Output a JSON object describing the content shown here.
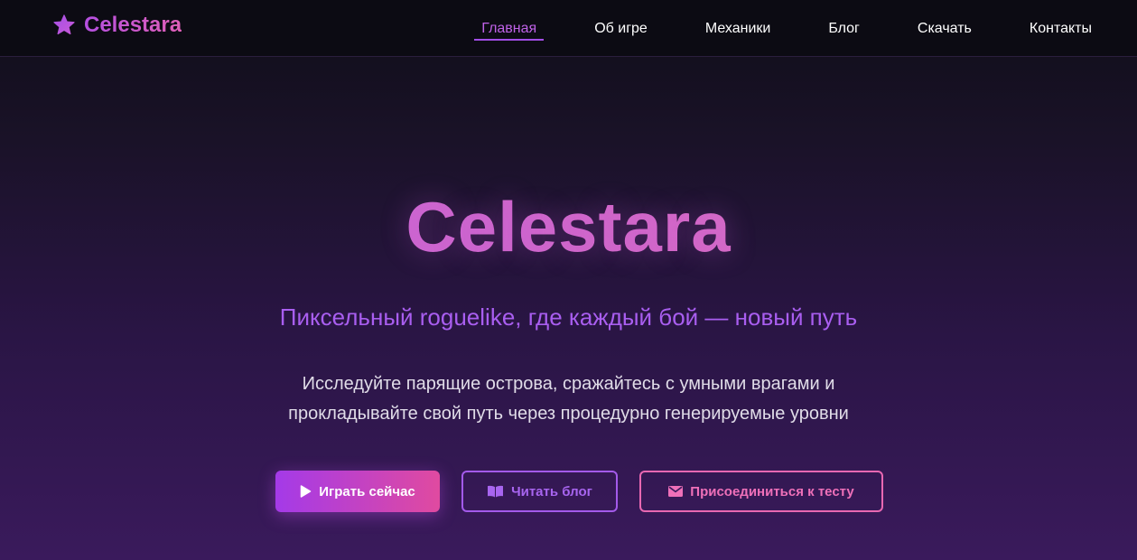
{
  "brand": {
    "name": "Celestara",
    "icon": "star-icon"
  },
  "nav": {
    "items": [
      {
        "label": "Главная",
        "active": true
      },
      {
        "label": "Об игре",
        "active": false
      },
      {
        "label": "Механики",
        "active": false
      },
      {
        "label": "Блог",
        "active": false
      },
      {
        "label": "Скачать",
        "active": false
      },
      {
        "label": "Контакты",
        "active": false
      }
    ]
  },
  "hero": {
    "title": "Celestara",
    "subtitle": "Пиксельный roguelike, где каждый бой — новый путь",
    "desc_line1": "Исследуйте парящие острова, сражайтесь с умными врагами и",
    "desc_line2": "прокладывайте свой путь через процедурно генерируемые уровни"
  },
  "actions": {
    "play": {
      "label": "Играть сейчас",
      "icon": "play-icon"
    },
    "blog": {
      "label": "Читать блог",
      "icon": "book-icon"
    },
    "join": {
      "label": "Присоединиться к тесту",
      "icon": "envelope-icon"
    }
  },
  "colors": {
    "accent_purple": "#a24de6",
    "accent_pink": "#e868b2",
    "nav_background": "#0c0b13"
  }
}
